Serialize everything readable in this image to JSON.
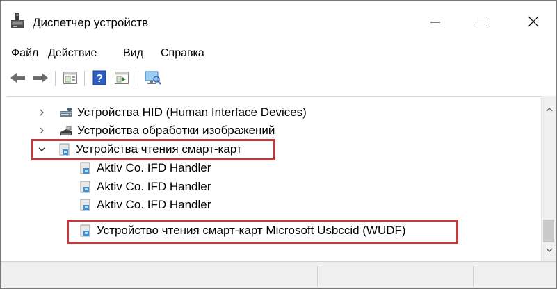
{
  "window": {
    "title": "Диспетчер устройств",
    "icon": "device-manager-icon",
    "controls": [
      "minimize",
      "maximize",
      "close"
    ]
  },
  "menu": {
    "items": [
      {
        "label": "Файл"
      },
      {
        "label": "Действие"
      },
      {
        "label": "Вид"
      },
      {
        "label": "Справка"
      }
    ]
  },
  "toolbar": {
    "buttons": [
      "back-arrow-icon",
      "forward-arrow-icon",
      "properties-icon",
      "help-icon",
      "update-driver-icon",
      "scan-hardware-icon"
    ]
  },
  "tree": {
    "rows": [
      {
        "label": "Устройства HID (Human Interface Devices)",
        "expanded": false,
        "icon": "hid-device-icon"
      },
      {
        "label": "Устройства обработки изображений",
        "expanded": false,
        "icon": "imaging-device-icon"
      },
      {
        "label": "Устройства чтения смарт-карт",
        "expanded": true,
        "icon": "smart-card-reader-icon",
        "highlighted": true
      },
      {
        "label": "Aktiv Co. IFD Handler",
        "icon": "smart-card-reader-icon"
      },
      {
        "label": "Aktiv Co. IFD Handler",
        "icon": "smart-card-reader-icon"
      },
      {
        "label": "Aktiv Co. IFD Handler",
        "icon": "smart-card-reader-icon"
      },
      {
        "label": "Устройство чтения смарт-карт Microsoft Usbccid (WUDF)",
        "icon": "smart-card-reader-icon",
        "highlighted": true
      }
    ]
  },
  "colors": {
    "highlight": "#c0393f",
    "scrollbar_thumb": "#c9c9c9"
  }
}
